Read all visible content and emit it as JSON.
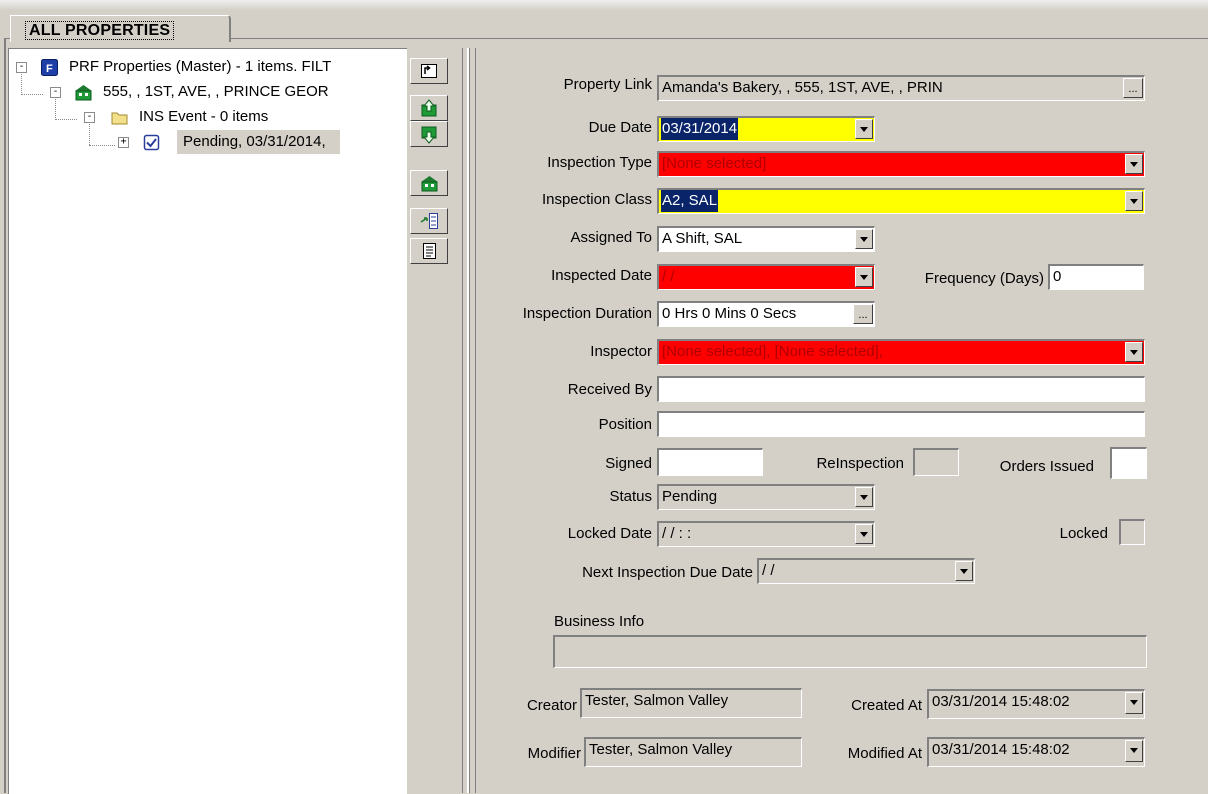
{
  "tab": {
    "label": "ALL PROPERTIES"
  },
  "tree": [
    {
      "text": "PRF  Properties (Master) - 1 items. FILT",
      "icon": "properties-master-icon",
      "expander": "-"
    },
    {
      "text": "555, , 1ST, AVE, , PRINCE GEOR",
      "icon": "property-building-icon",
      "expander": "-"
    },
    {
      "text": "INS Event - 0 items",
      "icon": "folder-icon",
      "expander": "-"
    },
    {
      "text": "Pending, 03/31/2014,",
      "icon": "inspection-check-icon",
      "expander": "+"
    }
  ],
  "toolbar": [
    {
      "name": "up-folder-icon"
    },
    {
      "name": "move-up-icon"
    },
    {
      "name": "move-down-icon"
    },
    {
      "name": "property-icon"
    },
    {
      "name": "assign-list-icon"
    },
    {
      "name": "report-icon"
    }
  ],
  "form": {
    "property_link": {
      "label": "Property Link",
      "value": "Amanda's Bakery, , 555, 1ST, AVE, , PRIN",
      "button": "..."
    },
    "due_date": {
      "label": "Due Date",
      "value": "03/31/2014"
    },
    "inspection_type": {
      "label": "Inspection Type",
      "value": "[None selected]"
    },
    "inspection_class": {
      "label": "Inspection Class",
      "value": "A2, SAL"
    },
    "assigned_to": {
      "label": "Assigned To",
      "value": "A Shift, SAL"
    },
    "inspected_date": {
      "label": "Inspected Date",
      "value": " /  / "
    },
    "frequency": {
      "label": "Frequency (Days)",
      "value": "0"
    },
    "inspection_duration": {
      "label": "Inspection Duration",
      "value": "0 Hrs 0 Mins 0 Secs",
      "button": "..."
    },
    "inspector": {
      "label": "Inspector",
      "value": "[None selected], [None selected],"
    },
    "received_by": {
      "label": "Received By",
      "value": ""
    },
    "position": {
      "label": "Position",
      "value": ""
    },
    "signed": {
      "label": "Signed",
      "value": ""
    },
    "reinspection": {
      "label": "ReInspection",
      "value": ""
    },
    "orders_issued": {
      "label": "Orders Issued",
      "value": ""
    },
    "status": {
      "label": "Status",
      "value": "Pending"
    },
    "locked_date": {
      "label": "Locked Date",
      "value": " /  /       :  : "
    },
    "locked": {
      "label": "Locked",
      "value": ""
    },
    "next_due": {
      "label": "Next Inspection Due Date",
      "value": " /  / "
    },
    "business_info": {
      "label": "Business Info",
      "value": ""
    },
    "creator": {
      "label": "Creator",
      "value": "Tester, Salmon Valley"
    },
    "created_at": {
      "label": "Created At",
      "value": "03/31/2014 15:48:02"
    },
    "modifier": {
      "label": "Modifier",
      "value": "Tester, Salmon Valley"
    },
    "modified_at": {
      "label": "Modified At",
      "value": "03/31/2014 15:48:02"
    }
  },
  "colors": {
    "window_bg": "#d4d0c8",
    "required_missing": "#ff0000",
    "required_highlight": "#ffff00",
    "selection": "#0a246a"
  }
}
